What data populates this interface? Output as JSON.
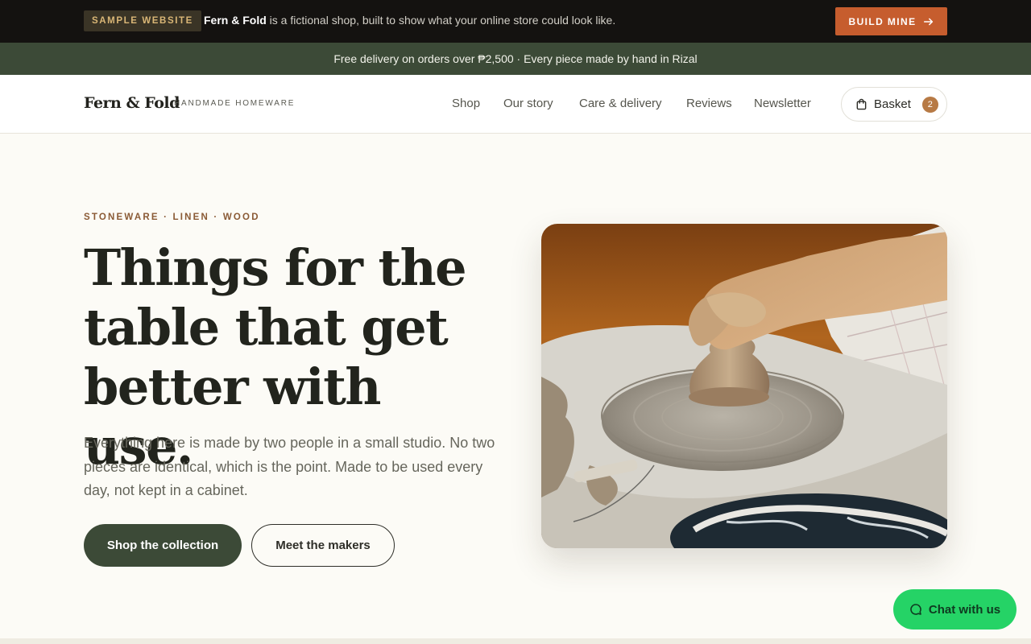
{
  "topbar": {
    "badge": "SAMPLE WEBSITE",
    "brand": "Fern & Fold",
    "message": " is a fictional shop, built to show what your online store could look like.",
    "cta": "BUILD MINE",
    "cta_icon": "arrow-right-icon"
  },
  "promo": {
    "text": "Free delivery on orders over ₱2,500 · Every piece made by hand in Rizal"
  },
  "header": {
    "logo": "Fern & Fold",
    "tagline": "HANDMADE HOMEWARE",
    "nav": [
      "Shop",
      "Our story",
      "Care & delivery",
      "Reviews",
      "Newsletter"
    ],
    "basket_label": "Basket",
    "basket_count": "2",
    "basket_icon": "shopping-bag-icon"
  },
  "hero": {
    "eyebrow": "STONEWARE · LINEN · WOOD",
    "headline": [
      "Things for the",
      "table that get",
      "better with use."
    ],
    "lead": "Everything here is made by two people in a small studio. No two pieces are identical, which is the point. Made to be used every day, not kept in a cabinet.",
    "primary_cta": "Shop the collection",
    "secondary_cta": "Meet the makers"
  },
  "chat": {
    "label": "Chat with us",
    "icon": "chat-bubble-icon",
    "color": "#25d366"
  },
  "colors": {
    "brand_green": "#3c4a37",
    "accent_orange": "#c65d2e",
    "background": "#fcfbf6"
  }
}
